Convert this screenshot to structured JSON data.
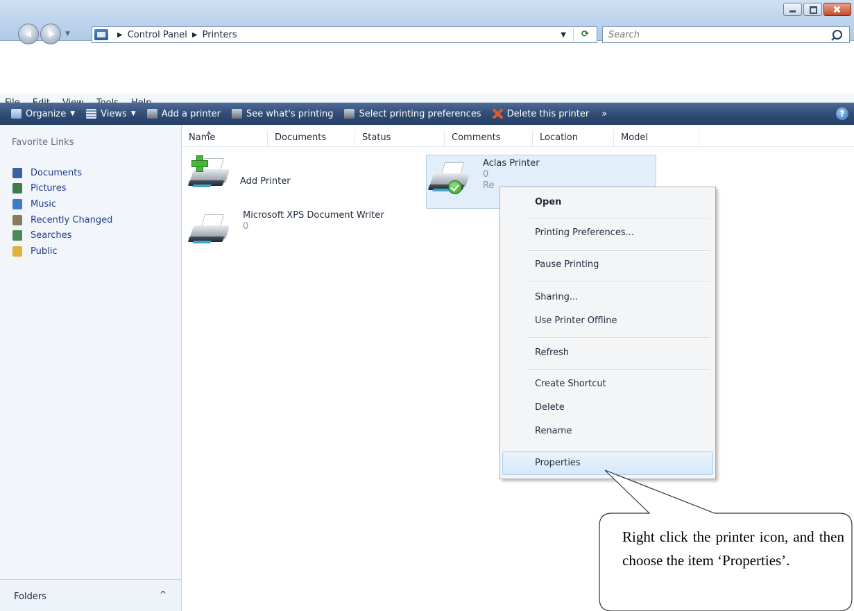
{
  "window": {
    "buttons": [
      "minimize-icon",
      "maximize-icon",
      "close-icon"
    ]
  },
  "address": {
    "crumbs": [
      "Control Panel",
      "Printers"
    ],
    "search_placeholder": "Search"
  },
  "menubar": {
    "items": [
      "File",
      "Edit",
      "View",
      "Tools",
      "Help"
    ]
  },
  "toolbar": {
    "items": [
      {
        "label": "Organize",
        "icon": "organize-icon",
        "dropdown": true
      },
      {
        "label": "Views",
        "icon": "views-icon",
        "dropdown": true
      },
      {
        "label": "Add a printer",
        "icon": "add-printer-icon"
      },
      {
        "label": "See what's printing",
        "icon": "print-queue-icon"
      },
      {
        "label": "Select printing preferences",
        "icon": "printing-preferences-icon"
      },
      {
        "label": "Delete this printer",
        "icon": "delete-icon"
      }
    ],
    "overflow": "»",
    "help": "?"
  },
  "sidebar": {
    "title": "Favorite Links",
    "items": [
      {
        "label": "Documents",
        "icon": "documents-icon",
        "color": "#3c5f9e"
      },
      {
        "label": "Pictures",
        "icon": "pictures-icon",
        "color": "#3f7a4a"
      },
      {
        "label": "Music",
        "icon": "music-icon",
        "color": "#3d7cc9"
      },
      {
        "label": "Recently Changed",
        "icon": "recent-icon",
        "color": "#8a7b5b"
      },
      {
        "label": "Searches",
        "icon": "searches-icon",
        "color": "#4b8a54"
      },
      {
        "label": "Public",
        "icon": "public-folder-icon",
        "color": "#e2b23c"
      }
    ],
    "folders_label": "Folders",
    "folders_caret": "^"
  },
  "columns": [
    "Name",
    "Documents",
    "Status",
    "Comments",
    "Location",
    "Model"
  ],
  "printers": [
    {
      "name": "Add Printer",
      "sub": ""
    },
    {
      "name": "Microsoft XPS Document Writer",
      "sub": "0"
    },
    {
      "name": "Aclas Printer",
      "docs": "0",
      "status": "Re"
    }
  ],
  "context_menu": {
    "open": "Open",
    "items": [
      "Printing Preferences...",
      "Pause Printing",
      "Sharing...",
      "Use Printer Offline",
      "Refresh",
      "Create Shortcut",
      "Delete",
      "Rename",
      "Properties"
    ]
  },
  "callout": {
    "text": "Right click the printer icon, and then choose the item ‘Properties’."
  }
}
